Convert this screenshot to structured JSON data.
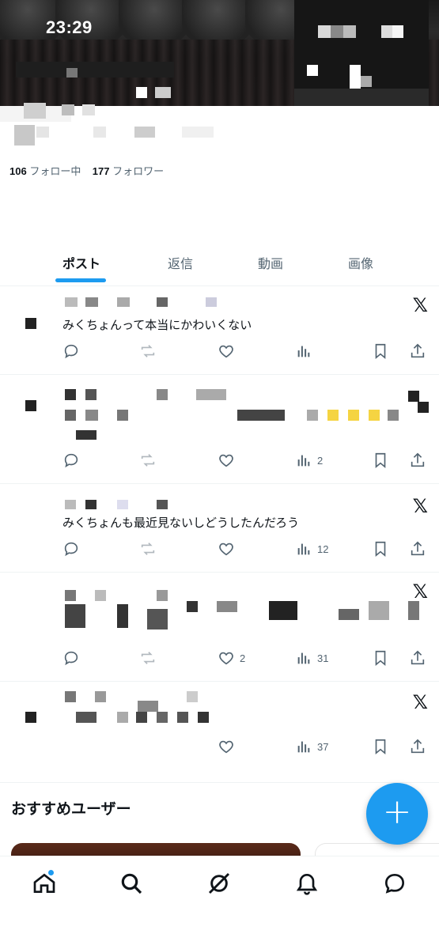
{
  "status_bar": {
    "time": "23:29"
  },
  "profile": {
    "following_count": "106",
    "following_label": "フォロー中",
    "followers_count": "177",
    "followers_label": "フォロワー"
  },
  "tabs": [
    {
      "label": "ポスト",
      "active": true
    },
    {
      "label": "返信",
      "active": false
    },
    {
      "label": "動画",
      "active": false
    },
    {
      "label": "画像",
      "active": false
    }
  ],
  "posts": [
    {
      "text": "みくちょんって本当にかわいくない",
      "views": "",
      "likes": ""
    },
    {
      "text": "",
      "views": "2",
      "likes": ""
    },
    {
      "text": "みくちょんも最近見ないしどうしたんだろう",
      "views": "12",
      "likes": ""
    },
    {
      "text": "",
      "views": "31",
      "likes": "2"
    },
    {
      "text": "",
      "views": "37",
      "likes": ""
    }
  ],
  "recommended": {
    "title": "おすすめユーザー"
  },
  "fab": {
    "label": "+"
  },
  "colors": {
    "accent": "#1d9bf0",
    "text": "#0f1419",
    "muted": "#536471"
  },
  "icons": [
    "reply-icon",
    "repost-icon",
    "like-icon",
    "views-icon",
    "bookmark-icon",
    "share-icon",
    "x-logo-icon",
    "home-icon",
    "search-icon",
    "grok-icon",
    "bell-icon",
    "messages-icon"
  ]
}
